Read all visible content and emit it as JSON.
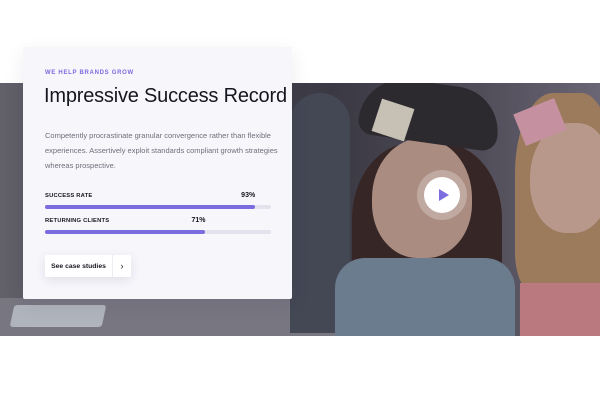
{
  "section": {
    "eyebrow": "WE HELP BRANDS GROW",
    "title": "Impressive Success Record",
    "description": "Competently procrastinate granular convergence rather than flexible experiences. Assertively exploit standards compliant growth strategies whereas prospective."
  },
  "stats": [
    {
      "label": "SUCCESS RATE",
      "value_text": "93%",
      "value": 93
    },
    {
      "label": "RETURNING CLIENTS",
      "value_text": "71%",
      "value": 71
    }
  ],
  "cta": {
    "label": "See case studies",
    "arrow": "›"
  },
  "video": {
    "play_icon": "play-icon"
  },
  "colors": {
    "accent": "#7b6ce0",
    "card_bg": "#f6f6fb",
    "track": "#e3e3ee",
    "text_dark": "#16161f",
    "text_muted": "#6f6f7a"
  }
}
